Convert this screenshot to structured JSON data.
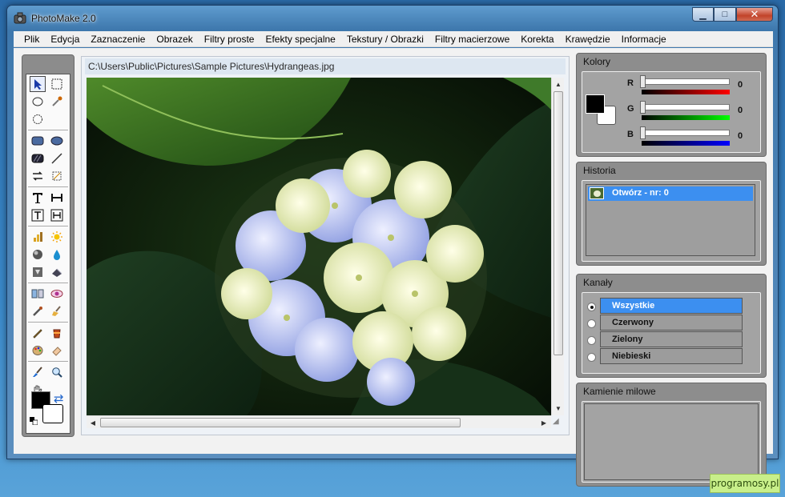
{
  "app": {
    "title": "PhotoMake 2.0"
  },
  "window_buttons": {
    "minimize": "▁",
    "maximize": "□",
    "close": "✕"
  },
  "menu": [
    "Plik",
    "Edycja",
    "Zaznaczenie",
    "Obrazek",
    "Filtry proste",
    "Efekty specjalne",
    "Tekstury / Obrazki",
    "Filtry macierzowe",
    "Korekta",
    "Krawędzie",
    "Informacje"
  ],
  "image": {
    "path": "C:\\Users\\Public\\Pictures\\Sample Pictures\\Hydrangeas.jpg"
  },
  "tools": {
    "icons": [
      "arrow-select-icon",
      "rect-select-icon",
      "ellipse-select-icon",
      "eyedropper-icon",
      "lasso-icon",
      "rounded-rect-icon",
      "ellipse-fill-icon",
      "hatch-fill-icon",
      "line-icon",
      "rotate-icon",
      "crop-icon",
      "text-icon",
      "text-width-icon",
      "text-box-icon",
      "text-height-icon",
      "levels-icon",
      "brightness-icon",
      "sphere-icon",
      "drop-icon",
      "emboss-icon",
      "stamp-icon",
      "mirror-icon",
      "eye-icon",
      "smudge-icon",
      "broom-icon",
      "pencil-icon",
      "bucket-icon",
      "palette-icon",
      "eraser-icon",
      "brush-icon",
      "zoom-icon",
      "hand-icon",
      "swap-colors-icon"
    ],
    "glyphs": {
      "swap": "⇄"
    }
  },
  "colors": {
    "title": "Kolory",
    "r_label": "R",
    "g_label": "G",
    "b_label": "B",
    "r": 0,
    "g": 0,
    "b": 0
  },
  "history": {
    "title": "Historia",
    "items": [
      "Otwórz - nr: 0"
    ]
  },
  "channels": {
    "title": "Kanały",
    "items": [
      "Wszystkie",
      "Czerwony",
      "Zielony",
      "Niebieski"
    ],
    "selected": "Wszystkie"
  },
  "milestones": {
    "title": "Kamienie milowe"
  },
  "watermark": "programosy.pl",
  "accent": "#3c8ff0"
}
